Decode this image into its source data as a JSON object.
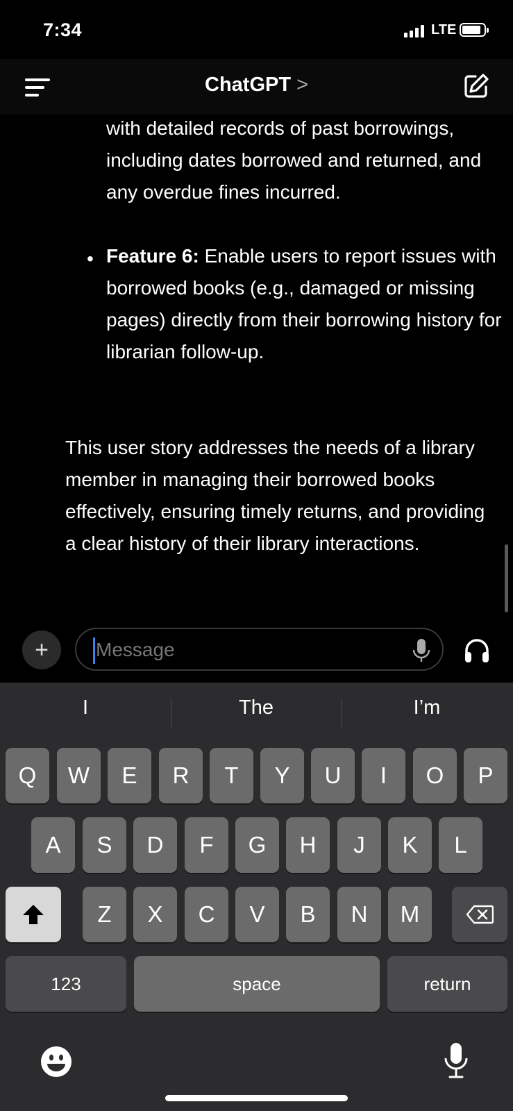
{
  "status_bar": {
    "time": "7:34",
    "network": "LTE"
  },
  "header": {
    "title": "ChatGPT",
    "title_chevron": ">",
    "menu_icon": "sidebar-menu-icon",
    "new_chat_icon": "edit-icon"
  },
  "conversation": {
    "para1": "with detailed records of past borrowings, including dates borrowed and returned, and any overdue fines incurred.",
    "bullet_marker": "•",
    "feature_label": "Feature 6:",
    "feature_text": " Enable users to report issues with borrowed books (e.g., damaged or missing pages) directly from their borrowing history for librarian follow-up.",
    "summary": "This user story addresses the needs of a library member in managing their borrowed books effectively, ensuring timely returns, and providing a clear history of their library interactions."
  },
  "composer": {
    "plus_label": "+",
    "placeholder": "Message"
  },
  "keyboard": {
    "suggestions": [
      "I",
      "The",
      "I’m"
    ],
    "row1": [
      "Q",
      "W",
      "E",
      "R",
      "T",
      "Y",
      "U",
      "I",
      "O",
      "P"
    ],
    "row2": [
      "A",
      "S",
      "D",
      "F",
      "G",
      "H",
      "J",
      "K",
      "L"
    ],
    "row3": [
      "Z",
      "X",
      "C",
      "V",
      "B",
      "N",
      "M"
    ],
    "numbers_label": "123",
    "space_label": "space",
    "return_label": "return"
  }
}
